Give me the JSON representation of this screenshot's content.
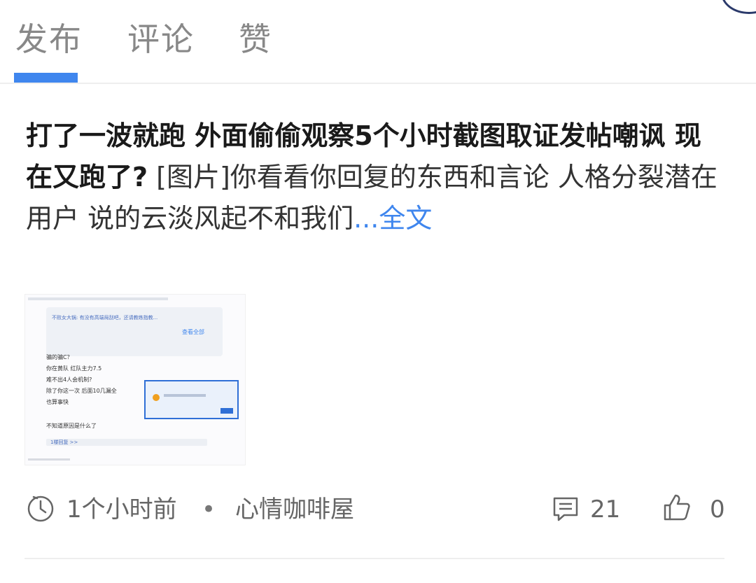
{
  "tabs": [
    {
      "label": "发布",
      "active": true
    },
    {
      "label": "评论",
      "active": false
    },
    {
      "label": "赞",
      "active": false
    }
  ],
  "accent_color": "#3f86ee",
  "post": {
    "title": "打了一波就跑 外面偷偷观察5个小时截图取证发帖嘲讽  现在又跑了?",
    "body": "     [图片]你看看你回复的东西和言论     人格分裂潜在用户  说的云淡风起不和我们",
    "more_link": "...全文"
  },
  "thumbnail": {
    "quote_text": "不败女大锅: 有没有高端局刮吧，还请教练指教...",
    "quote_button": "查看全部",
    "lines": [
      "骗的骗C？",
      "你在黄队  红队主力7.5",
      "难不出4人会机制?",
      "除了你这一次    后面10几漏全",
      "也算事快",
      "不知道原因是什么了"
    ],
    "reply_label": "1楼回复 >>"
  },
  "meta": {
    "clock_icon": "clock-icon",
    "time_ago": "1个小时前",
    "separator": "•",
    "forum": "心情咖啡屋",
    "comment_icon": "comment-icon",
    "comment_count": "21",
    "like_icon": "thumbs-up-icon",
    "like_count": "0"
  }
}
